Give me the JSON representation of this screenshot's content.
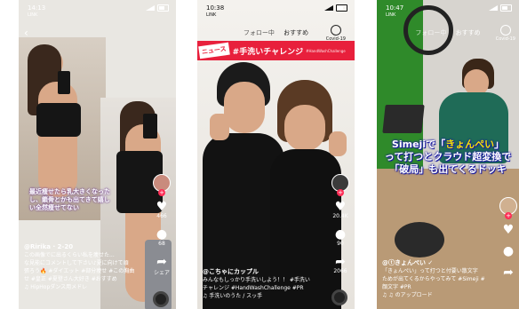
{
  "phones": [
    {
      "time": "14:13",
      "signal": "LINK",
      "overlay_text": "最近痩せたら乳大きくなったし、鎖骨とかも出てきて嬉しい全然痩せてない",
      "rail": {
        "likes": "466",
        "comments": "68",
        "share": "シェア"
      },
      "caption": {
        "user": "@Ririka · 2-20",
        "line1": "この画像でに出るくらい私を痩せた...",
        "line2": "な見能にコメントして下さい♪夏に向けて頑",
        "line3": "張ろう🔥 #ダイエット #部分痩せ #この胸曲",
        "line4": "せ #皇正 #夏登さん大好き #おすすめ"
      },
      "music": "♫ HipHopダンス用メドレ"
    },
    {
      "time": "10:38",
      "signal": "LINK",
      "nav": {
        "following": "フォロー中",
        "for_you": "おすすめ"
      },
      "covid": "Covid-19",
      "banner": {
        "news": "ニュース",
        "tag": "#手洗いチャレンジ",
        "sub": "#HandWashChallenge"
      },
      "rail": {
        "likes": "20.4K",
        "comments": "90",
        "share": "2066"
      },
      "caption": {
        "user": "@こちゃにカップル",
        "line1": "みんなもしっかり手洗いしよう！！ #手洗い",
        "line2": "チャレンジ #HandWashChallenge #PR"
      },
      "music": "♫ 手洗いのうた / スッ手"
    },
    {
      "time": "10:47",
      "signal": "LINK",
      "nav": {
        "following": "フォロー中",
        "for_you": "おすすめ"
      },
      "covid": "Covid-19",
      "overlay": {
        "l1a": "Simejiで「",
        "l1b": "きょんぺい",
        "l1c": "」",
        "l2": "って打つとクラウド超変換で",
        "l3": "「破局」も出てくるドッキ"
      },
      "caption": {
        "user": "@ⓣきょんぺい ✓",
        "line1": "「きょんぺい」って打つと付要い散文字",
        "line2": "ためが出てくるからやってみて #Simeji #",
        "line3": "顔文字 #PR"
      },
      "music": "♫ ♫ のアップロード"
    }
  ]
}
